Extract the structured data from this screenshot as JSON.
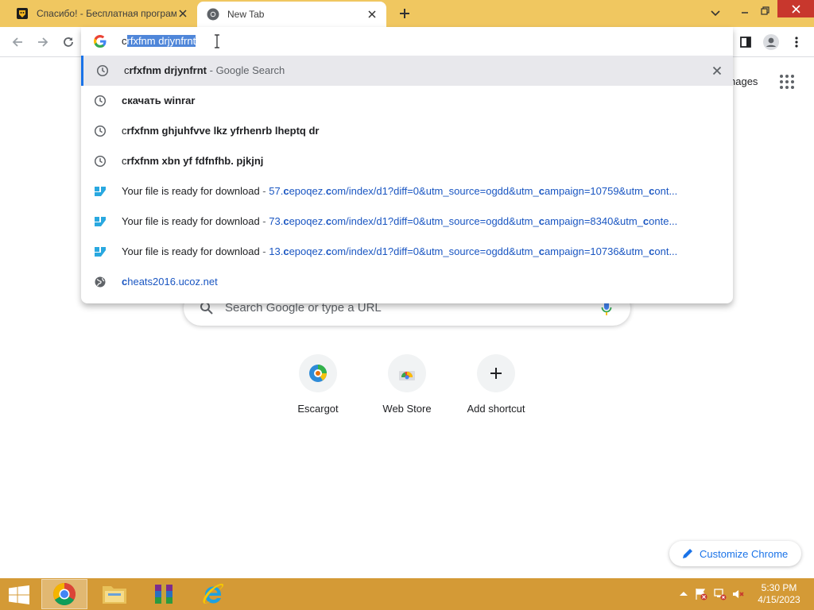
{
  "tabs": [
    {
      "title": "Спасибо! - Бесплатная програм",
      "favicon": "site-favicon-icon"
    },
    {
      "title": "New Tab",
      "favicon": "chrome-icon",
      "active": true
    }
  ],
  "omnibox": {
    "text_prefix": "c",
    "text_selected": "rfxfnm drjynfrnt"
  },
  "suggestions": [
    {
      "type": "history",
      "prefix": "c",
      "bold": "rfxfnm drjynfrnt",
      "sep": " - ",
      "suffix": "Google Search",
      "active": true
    },
    {
      "type": "history",
      "bold": "скачать winrar"
    },
    {
      "type": "history",
      "prefix": "c",
      "bold": "rfxfnm ghjuhfvve lkz yfrhenrb lheptq dr"
    },
    {
      "type": "history",
      "prefix": "c",
      "bold": "rfxfnm xbn yf fdfnfhb. pjkjnj"
    },
    {
      "type": "site",
      "title": "Your file is ready for download",
      "sep": " - ",
      "url_a": "57.",
      "url_b": "c",
      "url_c": "epoqez.",
      "url_d": "c",
      "url_e": "om/index/d1?diff=0&utm_source=ogdd&utm_",
      "url_f": "c",
      "url_g": "ampaign=10759&utm_",
      "url_h": "c",
      "url_i": "ont..."
    },
    {
      "type": "site",
      "title": "Your file is ready for download",
      "sep": " - ",
      "url_a": "73.",
      "url_b": "c",
      "url_c": "epoqez.",
      "url_d": "c",
      "url_e": "om/index/d1?diff=0&utm_source=ogdd&utm_",
      "url_f": "c",
      "url_g": "ampaign=8340&utm_",
      "url_h": "c",
      "url_i": "onte..."
    },
    {
      "type": "site",
      "title": "Your file is ready for download",
      "sep": " - ",
      "url_a": "13.",
      "url_b": "c",
      "url_c": "epoqez.",
      "url_d": "c",
      "url_e": "om/index/d1?diff=0&utm_source=ogdd&utm_",
      "url_f": "c",
      "url_g": "ampaign=10736&utm_",
      "url_h": "c",
      "url_i": "ont..."
    },
    {
      "type": "globe",
      "bold": "c",
      "rest": "heats2016.ucoz.net"
    }
  ],
  "ntp": {
    "images_label": "nages",
    "search_placeholder": "Search Google or type a URL",
    "shortcuts": [
      {
        "label": "Escargot",
        "icon": "escargot-icon"
      },
      {
        "label": "Web Store",
        "icon": "web-store-icon"
      },
      {
        "label": "Add shortcut",
        "icon": "plus-icon"
      }
    ],
    "customize_label": "Customize Chrome"
  },
  "taskbar": {
    "apps": [
      "chrome-icon",
      "file-explorer-icon",
      "winrar-icon",
      "internet-explorer-icon"
    ],
    "time": "5:30 PM",
    "date": "4/15/2023"
  },
  "colors": {
    "titlebar": "#f0c760",
    "taskbar": "#d49a36",
    "selection": "#4f86d9",
    "link_blue": "#1a73e8"
  }
}
